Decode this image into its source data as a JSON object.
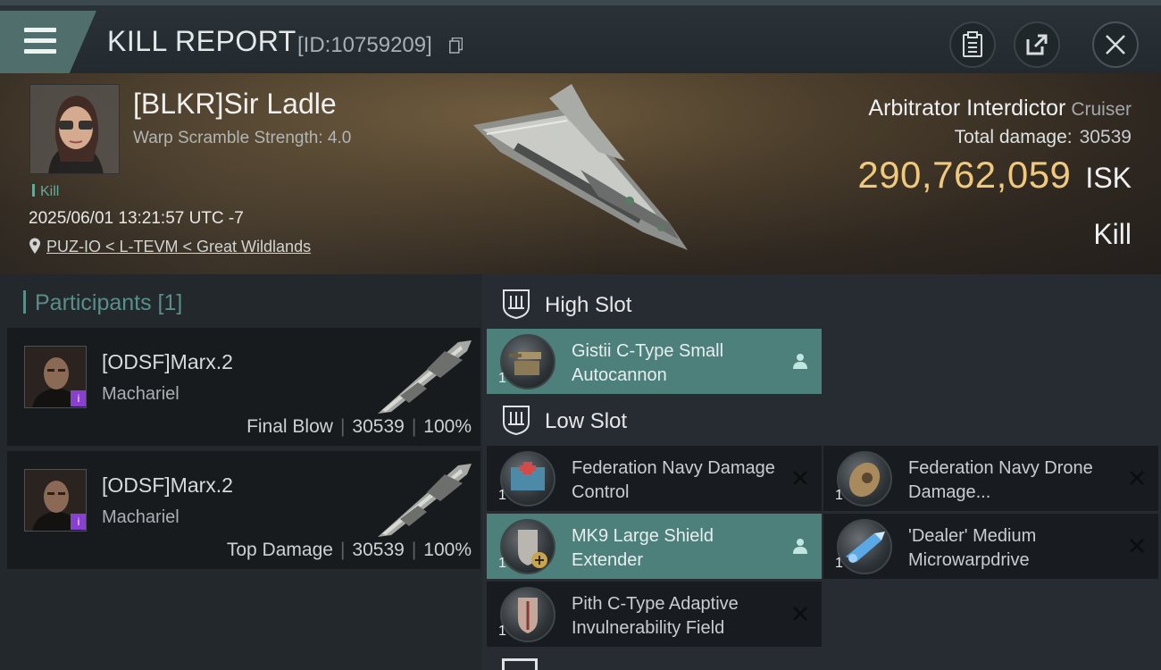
{
  "header": {
    "title": "KILL REPORT",
    "report_id": "[ID:10759209]"
  },
  "victim": {
    "name": "[BLKR]Sir Ladle",
    "warp_scramble": "Warp Scramble Strength: 4.0",
    "tag": "Kill",
    "datetime": "2025/06/01 13:21:57 UTC -7",
    "location": "PUZ-IO < L-TEVM < Great Wildlands",
    "ship_name": "Arbitrator Interdictor",
    "ship_class": "Cruiser",
    "total_damage_label": "Total damage:",
    "total_damage_value": "30539",
    "isk_value": "290,762,059",
    "isk_currency": "ISK",
    "result": "Kill"
  },
  "participants": {
    "heading": "Participants [1]",
    "items": [
      {
        "name": "[ODSF]Marx.2",
        "ship": "Machariel",
        "role": "Final Blow",
        "damage": "30539",
        "percent": "100%"
      },
      {
        "name": "[ODSF]Marx.2",
        "ship": "Machariel",
        "role": "Top Damage",
        "damage": "30539",
        "percent": "100%"
      }
    ]
  },
  "slots": {
    "high_label": "High Slot",
    "low_label": "Low Slot",
    "high_items": [
      {
        "qty": "1",
        "name": "Gistii C-Type Small Autocannon",
        "status": "fitted"
      }
    ],
    "low_items": [
      {
        "qty": "1",
        "name": "Federation Navy Damage Control",
        "status": "destroyed"
      },
      {
        "qty": "1",
        "name": "Federation Navy Drone Damage...",
        "status": "destroyed"
      },
      {
        "qty": "1",
        "name": "MK9 Large Shield Extender",
        "status": "fitted"
      },
      {
        "qty": "1",
        "name": "'Dealer' Medium Microwarpdrive",
        "status": "destroyed"
      },
      {
        "qty": "1",
        "name": "Pith C-Type Adaptive Invulnerability Field",
        "status": "destroyed"
      }
    ]
  },
  "colors": {
    "accent_teal": "#4d7f7b",
    "isk_gold": "#f0c97c",
    "kill_green": "#5fa899"
  }
}
